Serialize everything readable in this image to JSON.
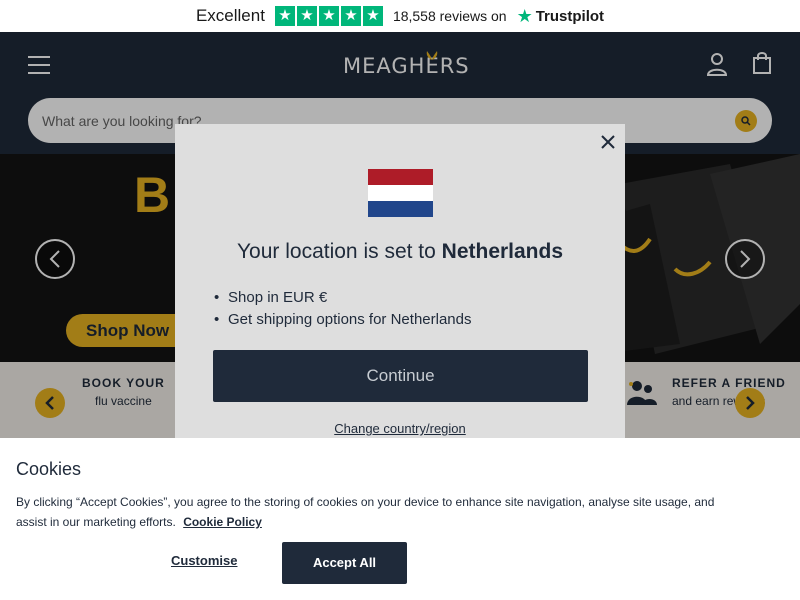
{
  "trustpilot": {
    "rating_word": "Excellent",
    "stars": 5,
    "reviews_text": "18,558 reviews on",
    "brand": "Trustpilot"
  },
  "header": {
    "logo_text": "MEAGHERS",
    "search_placeholder": "What are you looking for?"
  },
  "hero": {
    "title_fragment": "BL",
    "cta_label": "Shop Now"
  },
  "promo": {
    "items": [
      {
        "title": "BOOK YOUR",
        "subtitle": "flu vaccine"
      },
      {
        "title": "REFER A FRIEND",
        "subtitle": "and earn rewards"
      }
    ]
  },
  "location_modal": {
    "heading_prefix": "Your location is set to",
    "country": "Netherlands",
    "bullets": [
      "Shop in EUR €",
      "Get shipping options for Netherlands"
    ],
    "continue_label": "Continue",
    "change_label": "Change country/region",
    "flag_colors": [
      "#ae1c28",
      "#ffffff",
      "#21468b"
    ]
  },
  "cookies": {
    "title": "Cookies",
    "text": "By clicking “Accept Cookies”, you agree to the storing of cookies on your device to enhance site navigation, analyse site usage, and assist in our marketing efforts.",
    "policy_link": "Cookie Policy",
    "customise_label": "Customise",
    "accept_label": "Accept All"
  },
  "colors": {
    "navy": "#1f2a3a",
    "gold": "#e8b321",
    "trustpilot_green": "#00b67a"
  }
}
